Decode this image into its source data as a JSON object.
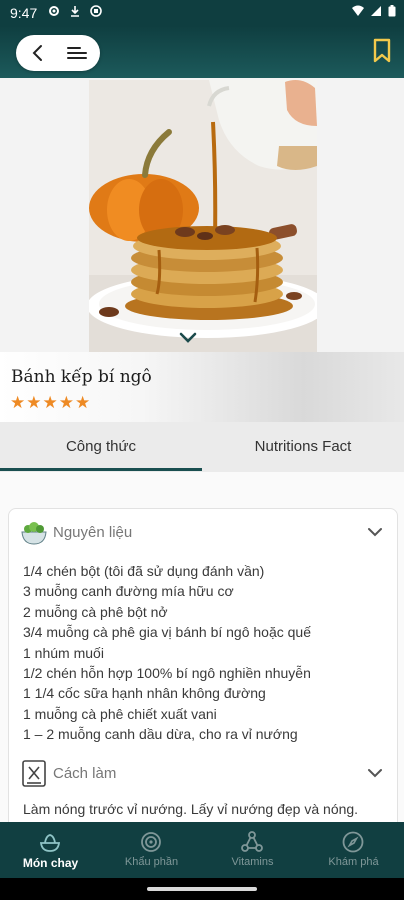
{
  "status_bar": {
    "time": "9:47"
  },
  "header": {
    "back_icon": "arrow-back-icon",
    "menu_icon": "menu-icon",
    "bookmark_icon": "bookmark-icon"
  },
  "recipe": {
    "title": "Bánh kếp bí ngô",
    "rating": 5,
    "stars": [
      "★",
      "★",
      "★",
      "★",
      "★"
    ],
    "star_color": "#ee8a24"
  },
  "tabs": [
    {
      "label": "Công thức",
      "active": true
    },
    {
      "label": "Nutritions Fact",
      "active": false
    }
  ],
  "ingredients": {
    "title": "Nguyên liệu",
    "items": [
      "1/4 chén bột (tôi đã sử dụng đánh vần)",
      "3 muỗng canh đường mía hữu cơ",
      "2 muỗng cà phê bột nở",
      "3/4 muỗng cà phê gia vị bánh bí ngô hoặc quế",
      "1 nhúm muối",
      "1/2 chén hỗn hợp 100% bí ngô nghiền nhuyễn",
      "1 1/4 cốc sữa hạnh nhân không đường",
      "1 muỗng cà phê chiết xuất vani",
      "1 – 2 muỗng canh dầu dừa, cho ra vỉ nướng"
    ]
  },
  "method": {
    "title": "Cách làm",
    "first_line": "Làm nóng trước vỉ nướng. Lấy vỉ nướng đẹp và nóng."
  },
  "bottom_nav": [
    {
      "label": "Món chay",
      "icon": "bowl-icon",
      "active": true
    },
    {
      "label": "Khẩu phần",
      "icon": "target-icon",
      "active": false
    },
    {
      "label": "Vitamins",
      "icon": "molecule-icon",
      "active": false
    },
    {
      "label": "Khám phá",
      "icon": "compass-icon",
      "active": false
    }
  ],
  "colors": {
    "primary": "#0f3e40",
    "accent": "#ee8a24",
    "bookmark": "#f2c94c"
  }
}
